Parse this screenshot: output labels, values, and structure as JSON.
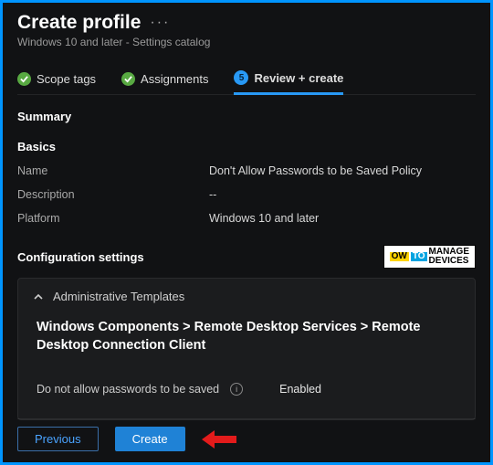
{
  "header": {
    "title": "Create profile",
    "subtitle": "Windows 10 and later - Settings catalog"
  },
  "tabs": {
    "scope": "Scope tags",
    "assign": "Assignments",
    "review_num": "5",
    "review": "Review + create"
  },
  "summary": {
    "heading": "Summary",
    "basics_heading": "Basics",
    "name_k": "Name",
    "name_v": "Don't Allow Passwords to be Saved Policy",
    "desc_k": "Description",
    "desc_v": "--",
    "plat_k": "Platform",
    "plat_v": "Windows 10 and later"
  },
  "config": {
    "heading": "Configuration settings",
    "watermark_left1": "OW",
    "watermark_left2": "TO",
    "watermark_r1": "MANAGE",
    "watermark_r2": "DEVICES"
  },
  "card": {
    "title": "Administrative Templates",
    "crumb": "Windows Components > Remote Desktop Services > Remote Desktop Connection Client",
    "policy": "Do not allow passwords to be saved",
    "info": "i",
    "state": "Enabled"
  },
  "footer": {
    "prev": "Previous",
    "create": "Create"
  }
}
